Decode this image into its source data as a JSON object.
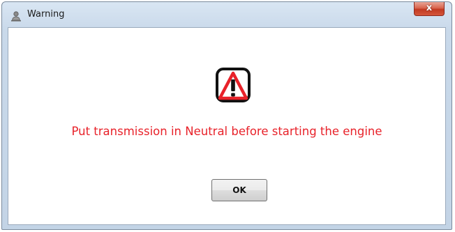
{
  "window": {
    "title": "Warning",
    "title_icon": "user-icon",
    "close_label": "x",
    "close_icon": "close-icon"
  },
  "dialog": {
    "icon": "warning-triangle-icon",
    "message": "Put transmission in Neutral before starting the engine",
    "ok_label": "OK"
  },
  "colors": {
    "message": "#e8222a",
    "icon_red": "#e8222a",
    "close_red": "#c23a22"
  }
}
